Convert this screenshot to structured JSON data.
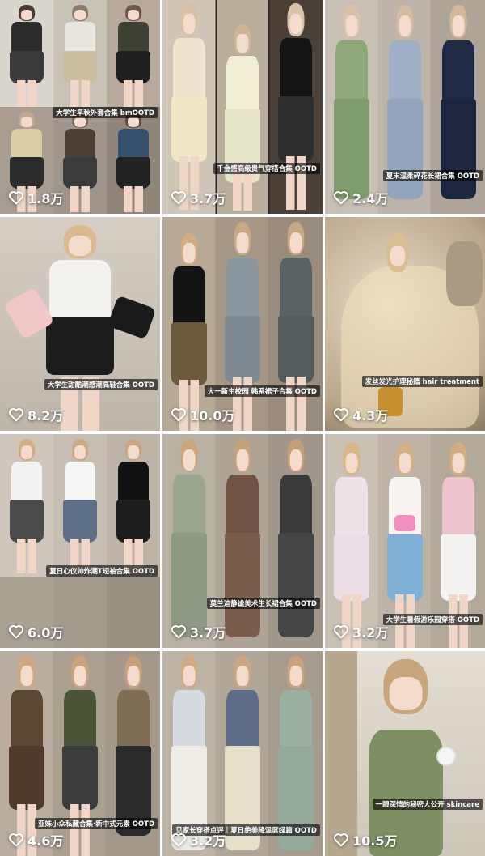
{
  "feed": {
    "tiles": [
      {
        "caption": "大学生早秋外套合集 bmOOTD",
        "likes": "1.8万"
      },
      {
        "caption": "千金感高级贵气穿搭合集 OOTD",
        "likes": "3.7万"
      },
      {
        "caption": "夏末温柔碎花长裙合集 OOTD",
        "likes": "2.4万"
      },
      {
        "caption": "大学生甜酷潮感潮高鞋合集 OOTD",
        "likes": "8.2万"
      },
      {
        "caption": "大一新生校园  韩系裙子合集 OOTD",
        "likes": "10.0万"
      },
      {
        "caption": "发丝发光护理秘籍 hair treatment",
        "likes": "4.3万"
      },
      {
        "caption": "夏日心仪帅炸潮T短袖合集 OOTD",
        "likes": "6.0万"
      },
      {
        "caption": "莫兰迪静谧美术生长裙合集 OOTD",
        "likes": "3.7万"
      },
      {
        "caption": "大学生暑假游乐园穿搭 OOTD",
        "likes": "3.2万"
      },
      {
        "caption": "亚妹小众私藏合集·新中式元素 OOTD",
        "likes": "4.6万"
      },
      {
        "caption": "见家长穿搭点评｜夏日绝美降温蓝绿篇 OOTD",
        "likes": "3.2万"
      },
      {
        "caption": "一眼深情的秘密大公开 skincare",
        "likes": "10.5万"
      }
    ]
  },
  "icons": {
    "like": "heart-outline-icon"
  },
  "colors": {
    "caption_bg": "#000000",
    "text": "#ffffff"
  }
}
